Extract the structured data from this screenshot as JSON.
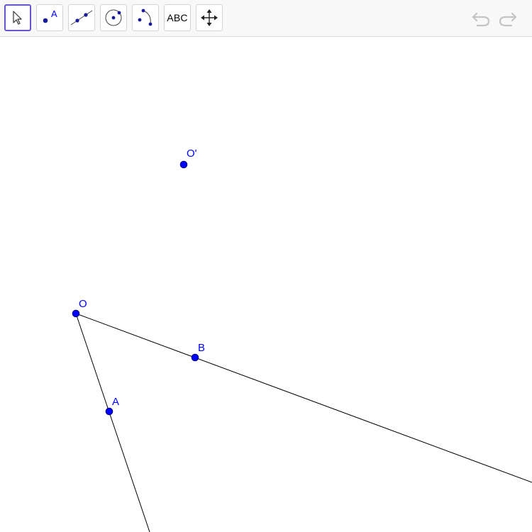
{
  "toolbar": {
    "tools": [
      {
        "name": "move-tool",
        "icon": "cursor-arrow-icon"
      },
      {
        "name": "point-tool",
        "icon": "point-icon",
        "label": "A"
      },
      {
        "name": "line-tool",
        "icon": "line-through-two-points-icon"
      },
      {
        "name": "circle-tool",
        "icon": "circle-with-center-icon"
      },
      {
        "name": "arc-tool",
        "icon": "arc-three-points-icon"
      },
      {
        "name": "text-tool",
        "label": "ABC"
      },
      {
        "name": "move-graphics-view-tool",
        "icon": "four-way-arrow-icon"
      }
    ],
    "undo_icon": "undo-icon",
    "redo_icon": "redo-icon"
  },
  "graphics": {
    "points": [
      {
        "id": "O-prime",
        "label": "O'"
      },
      {
        "id": "O",
        "label": "O"
      },
      {
        "id": "A",
        "label": "A"
      },
      {
        "id": "B",
        "label": "B"
      }
    ],
    "rays": [
      {
        "from": "O",
        "through": "A"
      },
      {
        "from": "O",
        "through": "B"
      }
    ],
    "colors": {
      "point": "#0000ff",
      "line": "#000000",
      "active_tool_border": "#6557d2"
    }
  }
}
